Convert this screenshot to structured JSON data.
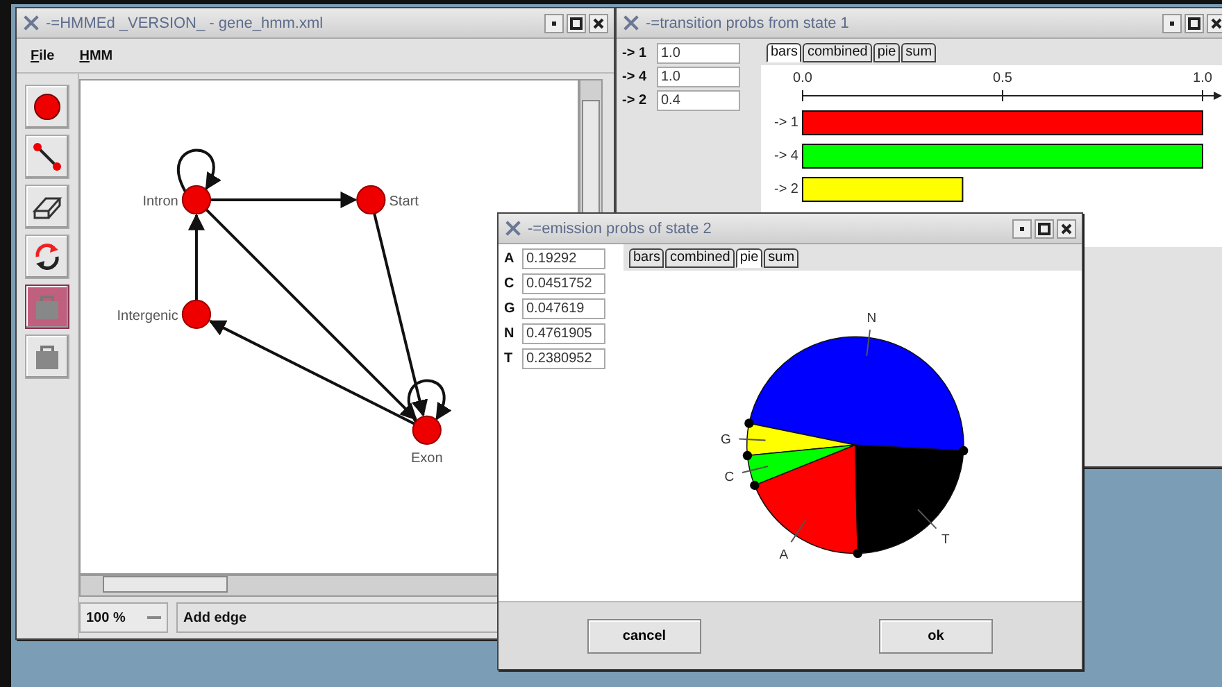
{
  "main_window": {
    "title": "-=HMMEd _VERSION_ - gene_hmm.xml",
    "menu": [
      "File",
      "HMM"
    ],
    "tools": [
      {
        "kind": "node",
        "selected": false
      },
      {
        "kind": "edge",
        "selected": false
      },
      {
        "kind": "eraser",
        "selected": false
      },
      {
        "kind": "swap",
        "selected": false
      },
      {
        "kind": "bag",
        "selected": true
      },
      {
        "kind": "bag",
        "selected": false
      }
    ],
    "graph": {
      "nodes": [
        {
          "label": "Intron"
        },
        {
          "label": "Start"
        },
        {
          "label": "Intergenic"
        },
        {
          "label": "Exon"
        }
      ]
    },
    "zoom": "100 %",
    "status": "Add edge"
  },
  "transition_window": {
    "title": "-=transition probs from state 1",
    "fields": [
      {
        "label": "-> 1",
        "value": "1.0"
      },
      {
        "label": "-> 4",
        "value": "1.0"
      },
      {
        "label": "-> 2",
        "value": "0.4"
      }
    ],
    "tabs": [
      {
        "label": "bars",
        "selected": true
      },
      {
        "label": "combined",
        "selected": false
      },
      {
        "label": "pie",
        "selected": false
      },
      {
        "label": "sum",
        "selected": false
      }
    ],
    "chart_data": {
      "type": "bar",
      "orientation": "horizontal",
      "categories": [
        "-> 1",
        "-> 4",
        "-> 2"
      ],
      "values": [
        1.0,
        1.0,
        0.4
      ],
      "colors": [
        "#ff0000",
        "#00ff00",
        "#ffff00"
      ],
      "xlim": [
        0,
        1
      ],
      "xticks": [
        {
          "value": 0,
          "label": "0.0"
        },
        {
          "value": 0.5,
          "label": "0.5"
        },
        {
          "value": 1,
          "label": "1.0"
        }
      ]
    }
  },
  "emission_window": {
    "title": "-=emission probs of state 2",
    "fields": [
      {
        "label": "A",
        "value": "0.19292"
      },
      {
        "label": "C",
        "value": "0.0451752"
      },
      {
        "label": "G",
        "value": "0.047619"
      },
      {
        "label": "N",
        "value": "0.4761905"
      },
      {
        "label": "T",
        "value": "0.2380952"
      }
    ],
    "tabs": [
      {
        "label": "bars",
        "selected": false
      },
      {
        "label": "combined",
        "selected": false
      },
      {
        "label": "pie",
        "selected": true
      },
      {
        "label": "sum",
        "selected": false
      }
    ],
    "chart_data": {
      "type": "pie",
      "categories": [
        "N",
        "G",
        "C",
        "A",
        "T"
      ],
      "values": [
        0.4761905,
        0.047619,
        0.0451752,
        0.19292,
        0.2380952
      ],
      "colors": [
        "#0000ff",
        "#ffff00",
        "#00ff00",
        "#ff0000",
        "#000000"
      ]
    },
    "buttons": [
      "cancel",
      "ok"
    ]
  }
}
